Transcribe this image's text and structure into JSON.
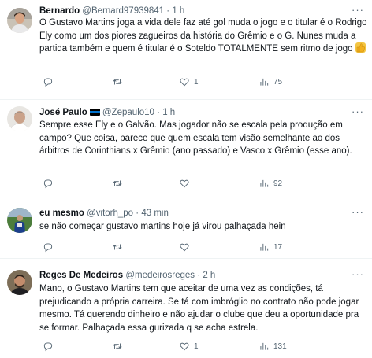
{
  "tweets": [
    {
      "name": "Bernardo",
      "handle": "@Bernard97939841",
      "dot": "·",
      "time": "1 h",
      "text": "O Gustavo Martins joga a vida dele faz até gol muda o jogo e o titular é o Rodrigo Ely como um dos piores zagueiros da história do Grêmio e o G. Nunes muda a partida também e quem é titular é o Soteldo TOTALMENTE sem ritmo de jogo ",
      "emoji": "thumbs-up-emoji",
      "reply_count": "",
      "retweet_count": "",
      "like_count": "1",
      "view_count": "75"
    },
    {
      "name": "José Paulo",
      "handle": "@Zepaulo10",
      "dot": "·",
      "time": "1 h",
      "text": "Sempre esse Ely e o Galvão. Mas jogador não se escala pela produção em campo? Que coisa, parece que quem escala tem visão semelhante ao dos árbitros de Corinthians x Grêmio (ano passado) e Vasco x Grêmio (esse ano).",
      "reply_count": "",
      "retweet_count": "",
      "like_count": "",
      "view_count": "92"
    },
    {
      "name": "eu mesmo",
      "handle": "@vitorh_po",
      "dot": "·",
      "time": "43 min",
      "text": "se não começar gustavo martins hoje já virou palhaçada hein",
      "reply_count": "",
      "retweet_count": "",
      "like_count": "",
      "view_count": "17"
    },
    {
      "name": "Reges De Medeiros",
      "handle": "@medeirosreges",
      "dot": "·",
      "time": "2 h",
      "text": "Mano, o Gustavo Martins tem que aceitar de uma vez as condições, tá prejudicando a própria carreira. Se tá com imbróglio no contrato não pode jogar mesmo. Tá querendo dinheiro e não ajudar o clube que deu a oportunidade pra se formar. Palhaçada essa gurizada q se acha estrela.",
      "reply_count": "",
      "retweet_count": "",
      "like_count": "1",
      "view_count": "131"
    }
  ],
  "icons": {
    "reply": "reply-icon",
    "retweet": "retweet-icon",
    "like": "heart-icon",
    "views": "views-icon",
    "more": "more-options-icon",
    "flag": "estonia-flag-icon"
  },
  "colors": {
    "text": "#0f1419",
    "secondary": "#536471",
    "divider": "#eff3f4"
  }
}
